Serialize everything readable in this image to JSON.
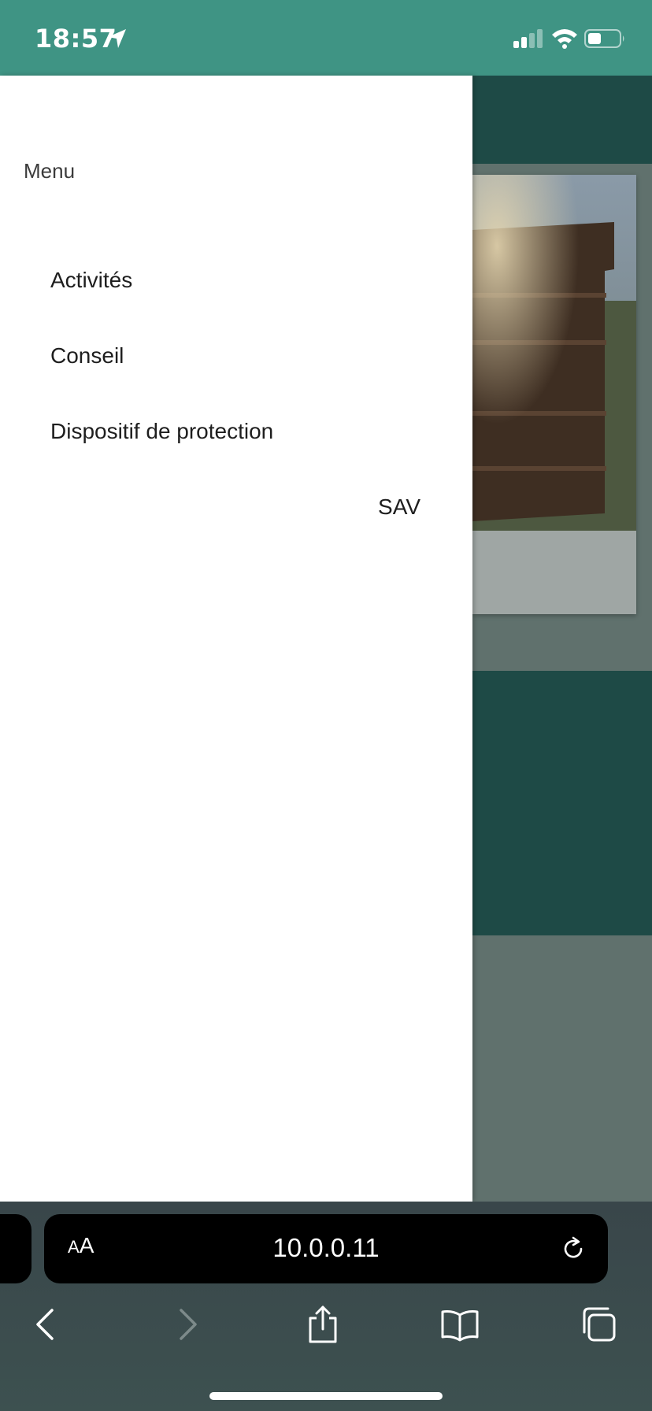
{
  "status_bar": {
    "time": "18:57",
    "icons": [
      "location-arrow-icon",
      "cellular-signal-icon",
      "wifi-icon",
      "battery-icon"
    ],
    "background_color": "#3f9484"
  },
  "drawer": {
    "title": "Menu",
    "items": [
      {
        "label": "Activités"
      },
      {
        "label": "Conseil"
      },
      {
        "label": "Dispositif de protection"
      },
      {
        "label": "SAV"
      }
    ]
  },
  "browser": {
    "text_size_label": "AA",
    "url": "10.0.0.11",
    "toolbar_icons": [
      "back-icon",
      "forward-icon",
      "share-icon",
      "bookmarks-icon",
      "tabs-icon"
    ]
  },
  "colors": {
    "accent": "#1e4a46",
    "status_bar": "#3f9484"
  }
}
